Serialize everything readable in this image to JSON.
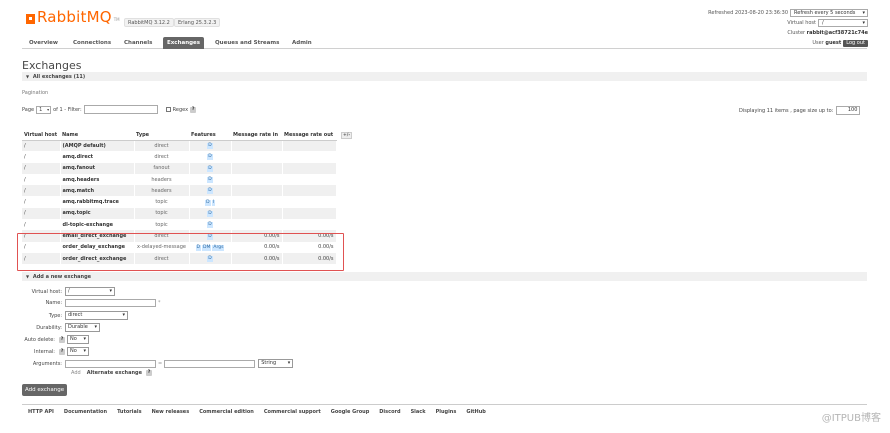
{
  "header": {
    "logo_text": "RabbitMQ",
    "logo_tm": "TM",
    "rabbitmq_version": "RabbitMQ 3.12.2",
    "erlang_version": "Erlang 25.3.2.3",
    "refreshed_text": "Refreshed 2023-08-20 23:36:30",
    "refresh_select": "Refresh every 5 seconds",
    "vhost_label": "Virtual host",
    "vhost_select": "/",
    "cluster_label": "Cluster",
    "cluster_name": "rabbit@acf38721c74e",
    "user_label": "User",
    "user_name": "guest",
    "logout_label": "Log out"
  },
  "tabs": [
    {
      "label": "Overview",
      "active": false
    },
    {
      "label": "Connections",
      "active": false
    },
    {
      "label": "Channels",
      "active": false
    },
    {
      "label": "Exchanges",
      "active": true
    },
    {
      "label": "Queues and Streams",
      "active": false
    },
    {
      "label": "Admin",
      "active": false
    }
  ],
  "page": {
    "title": "Exchanges",
    "all_exchanges_label": "All exchanges (11)",
    "pagination_label": "Pagination",
    "page_label": "Page",
    "page_value": "1",
    "of_label": "of 1",
    "filter_label": "- Filter:",
    "regex_label": "Regex",
    "help_mark": "?",
    "display_info": "Displaying 11 items , page size up to:",
    "page_size": "100"
  },
  "table": {
    "headers": [
      "Virtual host",
      "Name",
      "Type",
      "Features",
      "Message rate in",
      "Message rate out"
    ],
    "plus_minus": "+/-",
    "rows": [
      {
        "vhost": "/",
        "name": "(AMQP default)",
        "type": "direct",
        "features": [
          "D"
        ],
        "rate_in": "",
        "rate_out": ""
      },
      {
        "vhost": "/",
        "name": "amq.direct",
        "type": "direct",
        "features": [
          "D"
        ],
        "rate_in": "",
        "rate_out": ""
      },
      {
        "vhost": "/",
        "name": "amq.fanout",
        "type": "fanout",
        "features": [
          "D"
        ],
        "rate_in": "",
        "rate_out": ""
      },
      {
        "vhost": "/",
        "name": "amq.headers",
        "type": "headers",
        "features": [
          "D"
        ],
        "rate_in": "",
        "rate_out": ""
      },
      {
        "vhost": "/",
        "name": "amq.match",
        "type": "headers",
        "features": [
          "D"
        ],
        "rate_in": "",
        "rate_out": ""
      },
      {
        "vhost": "/",
        "name": "amq.rabbitmq.trace",
        "type": "topic",
        "features": [
          "D",
          "I"
        ],
        "rate_in": "",
        "rate_out": ""
      },
      {
        "vhost": "/",
        "name": "amq.topic",
        "type": "topic",
        "features": [
          "D"
        ],
        "rate_in": "",
        "rate_out": ""
      },
      {
        "vhost": "/",
        "name": "dl-topic-exchange",
        "type": "topic",
        "features": [
          "D"
        ],
        "rate_in": "",
        "rate_out": ""
      },
      {
        "vhost": "/",
        "name": "email_direct_exchange",
        "type": "direct",
        "features": [
          "D"
        ],
        "rate_in": "0.00/s",
        "rate_out": "0.00/s"
      },
      {
        "vhost": "/",
        "name": "order_delay_exchange",
        "type": "x-delayed-message",
        "features": [
          "D",
          "DM",
          "Args"
        ],
        "rate_in": "0.00/s",
        "rate_out": "0.00/s"
      },
      {
        "vhost": "/",
        "name": "order_direct_exchange",
        "type": "direct",
        "features": [
          "D"
        ],
        "rate_in": "0.00/s",
        "rate_out": "0.00/s"
      }
    ]
  },
  "add_exchange": {
    "section_label": "Add a new exchange",
    "vhost_label": "Virtual host:",
    "vhost_value": "/",
    "name_label": "Name:",
    "required_mark": "*",
    "type_label": "Type:",
    "type_value": "direct",
    "durability_label": "Durability:",
    "durability_value": "Durable",
    "auto_delete_label": "Auto delete:",
    "auto_delete_value": "No",
    "internal_label": "Internal:",
    "internal_value": "No",
    "arguments_label": "Arguments:",
    "eq_mark": "=",
    "arg_type_value": "String",
    "add_link": "Add",
    "alternate_exchange": "Alternate exchange",
    "help_mark": "?",
    "submit_label": "Add exchange"
  },
  "footer": {
    "links": [
      "HTTP API",
      "Documentation",
      "Tutorials",
      "New releases",
      "Commercial edition",
      "Commercial support",
      "Google Group",
      "Discord",
      "Slack",
      "Plugins",
      "GitHub"
    ]
  },
  "watermark": "@ITPUB博客",
  "colors": {
    "brand": "#ff6600",
    "tab_active": "#666666",
    "highlight": "#e05252",
    "feature_tag": "#cce6ff"
  }
}
